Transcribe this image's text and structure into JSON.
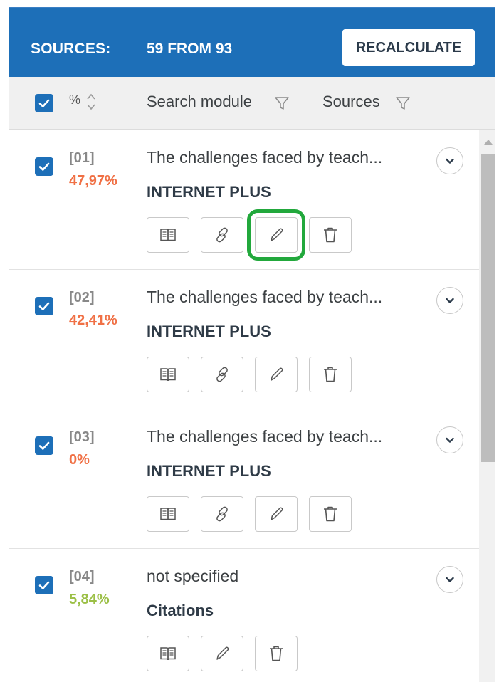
{
  "header": {
    "label": "SOURCES:",
    "count": "59 FROM 93",
    "recalculate_label": "RECALCULATE"
  },
  "columns": {
    "percent": "%",
    "search_module": "Search module",
    "sources": "Sources"
  },
  "colors": {
    "header_bg": "#1d6fb8",
    "checkbox": "#1d6fb8",
    "percent_high": "#f07045",
    "percent_low": "#9bbf45",
    "highlight": "#22a83c"
  },
  "sources": [
    {
      "num": "[01]",
      "percent": "47,97%",
      "percent_color": "#f07045",
      "title": "The challenges faced by teach...",
      "module": "INTERNET PLUS",
      "actions": [
        "book-icon",
        "link-icon",
        "pencil-icon",
        "trash-icon"
      ],
      "highlighted_action": "pencil-icon"
    },
    {
      "num": "[02]",
      "percent": "42,41%",
      "percent_color": "#f07045",
      "title": "The challenges faced by teach...",
      "module": "INTERNET PLUS",
      "actions": [
        "book-icon",
        "link-icon",
        "pencil-icon",
        "trash-icon"
      ]
    },
    {
      "num": "[03]",
      "percent": "0%",
      "percent_color": "#f07045",
      "title": "The challenges faced by teach...",
      "module": "INTERNET PLUS",
      "actions": [
        "book-icon",
        "link-icon",
        "pencil-icon",
        "trash-icon"
      ]
    },
    {
      "num": "[04]",
      "percent": "5,84%",
      "percent_color": "#9bbf45",
      "title": "not specified",
      "module": "Citations",
      "actions": [
        "book-icon",
        "pencil-icon",
        "trash-icon"
      ]
    }
  ]
}
